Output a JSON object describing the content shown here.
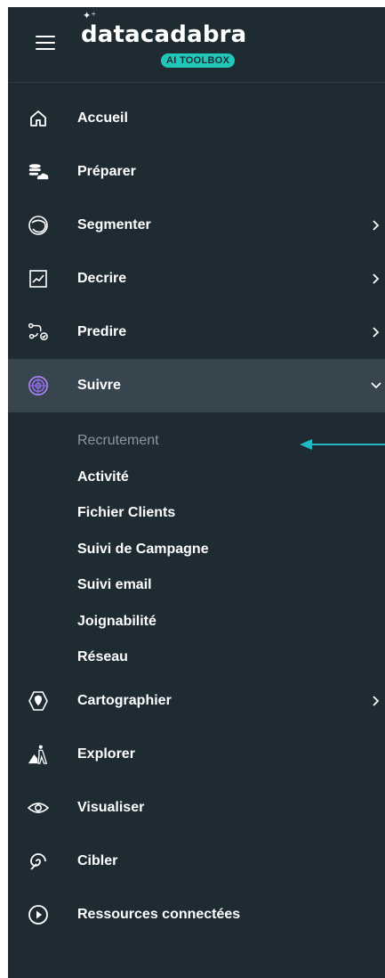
{
  "brand": {
    "name": "datacadabra",
    "badge": "AI TOOLBOX",
    "accent_color": "#21c7b8",
    "sidebar_bg": "#1f2b33",
    "active_bg": "#37454f"
  },
  "nav": {
    "accueil": {
      "label": "Accueil",
      "icon": "home-icon"
    },
    "preparer": {
      "label": "Préparer",
      "icon": "database-cloud-icon"
    },
    "segmenter": {
      "label": "Segmenter",
      "icon": "segment-circle-icon",
      "expandable": true
    },
    "decrire": {
      "label": "Decrire",
      "icon": "chart-frame-icon",
      "expandable": true
    },
    "predire": {
      "label": "Predire",
      "icon": "predict-path-icon",
      "expandable": true
    },
    "suivre": {
      "label": "Suivre",
      "icon": "target-icon",
      "expanded": true,
      "active": true
    },
    "cartographier": {
      "label": "Cartographier",
      "icon": "map-hexagon-icon",
      "expandable": true
    },
    "explorer": {
      "label": "Explorer",
      "icon": "explorer-mountain-icon"
    },
    "visualiser": {
      "label": "Visualiser",
      "icon": "eye-icon"
    },
    "cibler": {
      "label": "Cibler",
      "icon": "spiral-target-icon"
    },
    "ressources": {
      "label": "Ressources connectées",
      "icon": "play-circle-icon"
    }
  },
  "suivre_submenu": [
    {
      "label": "Recrutement",
      "current": true
    },
    {
      "label": "Activité"
    },
    {
      "label": "Fichier Clients"
    },
    {
      "label": "Suivi de Campagne"
    },
    {
      "label": "Suivi email"
    },
    {
      "label": "Joignabilité"
    },
    {
      "label": "Réseau"
    }
  ],
  "annotation": {
    "arrow_color": "#21b8c4"
  }
}
